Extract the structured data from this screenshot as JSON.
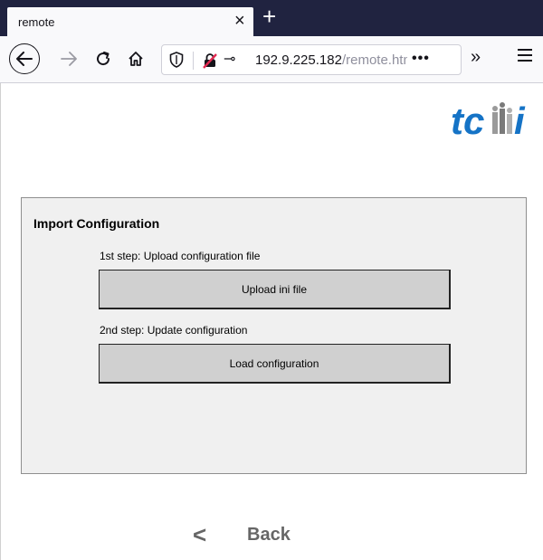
{
  "browser": {
    "tab_title": "remote",
    "tab_close": "×",
    "new_tab": "+",
    "url_host": "192.9.225.182",
    "url_path": "/remote.htm",
    "url_more": "•••",
    "overflow": "»"
  },
  "page": {
    "logo_text": "tc",
    "logo_text_end": "i",
    "panel": {
      "title": "Import Configuration",
      "step1_label": "1st step: Upload configuration file",
      "step1_button": "Upload ini file",
      "step2_label": "2nd step: Update configuration",
      "step2_button": "Load configuration"
    },
    "back_label": "Back",
    "back_chevron": "<"
  },
  "colors": {
    "tabstrip": "#202340",
    "logo_blue": "#1573c6",
    "logo_gray": "#8a8a8a",
    "panel_bg": "#f0f0f0",
    "button_bg": "#d0d0d0",
    "back_gray": "#666666"
  }
}
